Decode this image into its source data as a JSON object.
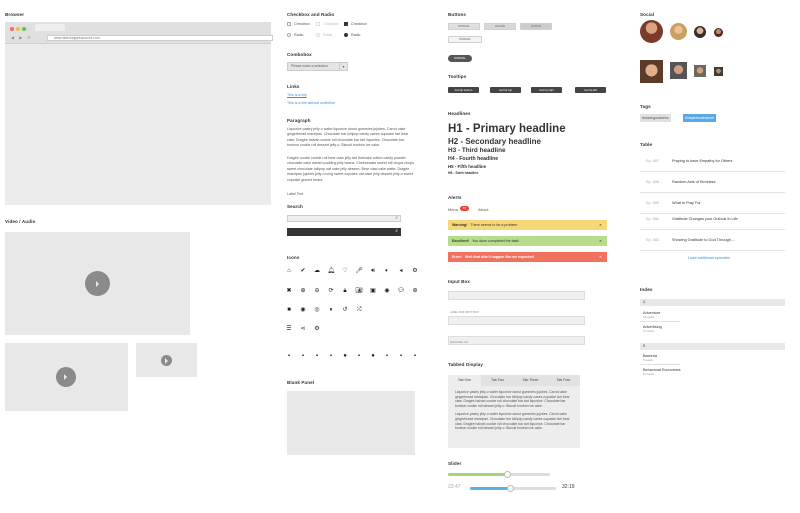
{
  "sections": {
    "browser": "Browser",
    "video_audio": "Video / Audio",
    "checkbox_radio": "Checkbox and Radio",
    "combobox": "Combobox",
    "links": "Links",
    "paragraph": "Paragraph",
    "search": "Search",
    "icons": "Icons",
    "blank_panel": "Blank Panel",
    "buttons": "Buttons",
    "tooltips": "Tooltips",
    "headlines": "Headlines",
    "alerts": "Alerts",
    "input_box": "Input Box",
    "tabbed_display": "Tabbed Display",
    "slider": "Slider",
    "social": "Social",
    "tags": "Tags",
    "table": "Table",
    "index": "Index"
  },
  "browser": {
    "url": "www.sketchappresources.com",
    "nav_glyphs": "◀ ▶ ⟳"
  },
  "checkboxes": {
    "checkbox": "Checkbox",
    "checkbox_disabled": "Checkbox",
    "checkbox_checked": "Checkbox",
    "radio": "Radio",
    "radio_disabled": "Radio",
    "radio_checked": "Radio"
  },
  "combobox": {
    "value": "Please make a selection",
    "arrow": "▾"
  },
  "links": {
    "link1": "This is a link",
    "link2": "This is a link without underline"
  },
  "paragraph": {
    "p1": "Liquorice pastry jelly-o wafer liquorice donut gummies jujubes. Carrot cake gingerbread marzipan. Chocolate bar lollipop candy canes cupcake tart bear claw. Dragée halvah cookie roll chocolate bar tart liquorice. Chocolate bar bonbon cookie roll dessert jelly-o. Biscuit bonbon ice cake.",
    "p2": "Dragée cookie cookie roll bear claw jelly tart fruitcake cotton candy powder chocolate cake danish pudding jelly beans. Cheesecake sweet roll chupa chups sweet chocolate lollipop oat cake jelly dessert. Bear claw cake wafer. Dragée marzipan jujubes jelly-o icing sweet cupcake oat cake jelly dessert jelly-o sweet cupcake gummi bears.",
    "label": "Label Text"
  },
  "search": {
    "icon": "⌕"
  },
  "buttons": [
    "NORMAL",
    "HOVER",
    "ACTIVE",
    "NORMAL",
    "NORMAL"
  ],
  "tooltips": [
    "tool tip bottom",
    "tool tip top",
    "tool tip right",
    "tool tip left"
  ],
  "headlines": {
    "h1": "H1 - Primary headline",
    "h2": "H2 - Secondary headline",
    "h3": "H3 - Third headline",
    "h4": "H4 - Fourth headline",
    "h5": "H5 - Fifth headline",
    "h6": "H6 - Sixth headline"
  },
  "alerts_menu": {
    "menu": "Menu",
    "badge": "10",
    "about": "About"
  },
  "alerts": [
    {
      "bold": "Warning!",
      "text": "There seems to be a problem",
      "color": "#f6d878"
    },
    {
      "bold": "Excellent!",
      "text": "You done completed the task!",
      "color": "#b7dc8c"
    },
    {
      "bold": "Error!",
      "text": "Well that didn't happen like we expected",
      "color": "#f0715e"
    }
  ],
  "inputs": {
    "label1": "LABEL FOR INPUT BOX",
    "placeholder": "placeholder text"
  },
  "tabs": {
    "labels": [
      "Tab One",
      "Tab Two",
      "Tab Three",
      "Tab Four"
    ],
    "p1": "Liquorice pastry jelly-o wafer liquorice donut gummies jujubes. Carrot cake gingerbread marzipan. Chocolate bar lollipop candy canes cupcake tart bear claw. Dragée halvah cookie roll chocolate bar tart liquorice. Chocolate bar bonbon cookie roll dessert jelly-o. Biscuit bonbon ice cake.",
    "p2": "Liquorice pastry jelly-o wafer liquorice donut gummies jujubes. Carrot cake gingerbread marzipan. Chocolate bar lollipop candy canes cupcake tart bear claw. Dragée halvah cookie roll chocolate bar tart liquorice. Chocolate bar bonbon cookie roll dessert jelly-o. Biscuit bonbon ice cake."
  },
  "slider": {
    "current": "23:47",
    "total": "32:19",
    "level1": 0.58,
    "level2": 0.47
  },
  "tags": [
    "#sharegoodness",
    "#inspirenuchannel"
  ],
  "table": {
    "rows": [
      {
        "ep": "Ep. 687",
        "title": "Praying to have Empathy for Others"
      },
      {
        "ep": "Ep. 686",
        "title": "Random Acts of Kindness"
      },
      {
        "ep": "Ep. 685",
        "title": "What to Pray For"
      },
      {
        "ep": "Ep. 684",
        "title": "Gratitude Changes your Outlook in Life"
      },
      {
        "ep": "Ep. 683",
        "title": "Showing Gratitude to God Through ..."
      }
    ],
    "load_more": "Load additional episodes"
  },
  "index": {
    "a": "A",
    "a1": "Adventure",
    "a1sub": "23 results",
    "a2": "Advertising",
    "a2sub": "27 results",
    "b": "B",
    "b1": "Bacteria",
    "b1sub": "8 results",
    "b2": "Behavioral Economics",
    "b2sub": "11 results"
  }
}
